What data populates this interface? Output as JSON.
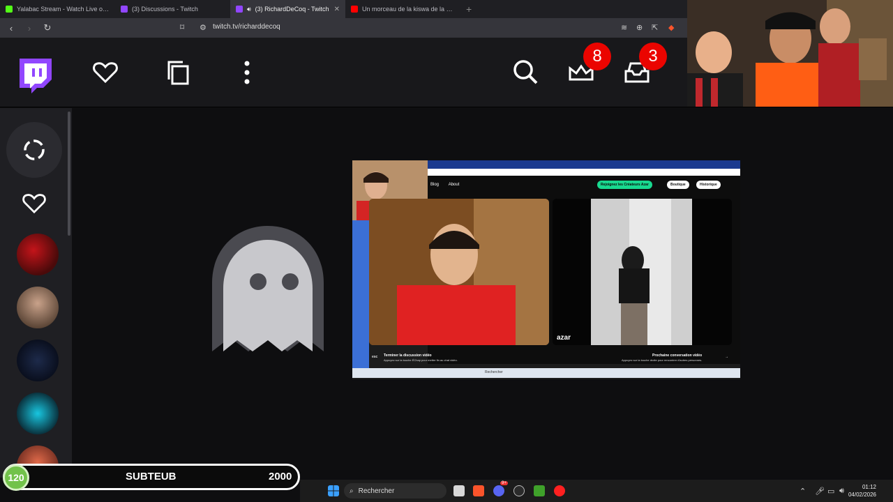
{
  "browser": {
    "tabs": [
      {
        "title": "Yalabac Stream - Watch Live on Kick",
        "favicon_color": "#53fc18"
      },
      {
        "title": "(3) Discussions - Twitch",
        "favicon_color": "#9146ff"
      },
      {
        "title": "(3) RichardDeCoq - Twitch",
        "favicon_color": "#9146ff",
        "active": true
      },
      {
        "title": "Un morceau de la kiswa de la Kaaba",
        "favicon_color": "#ff0000"
      }
    ],
    "new_tab": "+",
    "close_glyph": "✕",
    "url": "twitch.tv/richarddecoq"
  },
  "twitch_nav": {
    "notifications_count": "8",
    "inbox_count": "3",
    "brand_color": "#9146ff",
    "icons": [
      "twitch-logo-icon",
      "heart-icon",
      "copy-icon",
      "more-vertical-icon",
      "search-icon",
      "crown-icon",
      "inbox-icon"
    ]
  },
  "sidebar": {
    "icons": [
      "rotate-icon",
      "heart-icon"
    ],
    "avatars": [
      "channel-avatar-1",
      "channel-avatar-2",
      "channel-avatar-3",
      "channel-avatar-4",
      "channel-avatar-5"
    ]
  },
  "embedded_screen": {
    "site_nav": [
      "Blog",
      "About"
    ],
    "pill_join": "Rejoignez les Créateurs Azar",
    "pill_shop": "Boutique",
    "pill_history": "Historique",
    "brand": "azar",
    "end_call_title": "Terminer la discussion vidéo",
    "end_call_sub": "Appuyez sur la touche ÉChap pour mettre fin au chat vidéo.",
    "esc_key": "esc",
    "next_title": "Prochaine conversation vidéo",
    "next_sub": "Appuyez sur la touche droite pour rencontrer d'autres personnes.",
    "search_placeholder": "Rechercher"
  },
  "subathon": {
    "count": "120",
    "name": "SUBTEUB",
    "goal": "2000",
    "accent": "#72c24a"
  },
  "taskbar": {
    "search_placeholder": "Rechercher",
    "time": "01:12",
    "date": "04/02/2026",
    "discord_badge": "9+"
  }
}
